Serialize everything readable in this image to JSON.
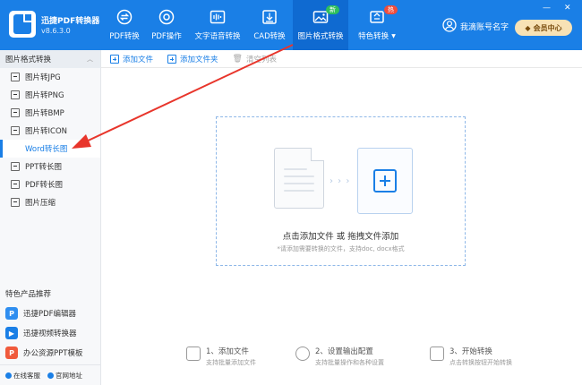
{
  "app": {
    "name": "迅捷PDF转换器",
    "version": "v8.6.3.0"
  },
  "nav": [
    {
      "label": "PDF转换",
      "icon": "pdf-convert-icon"
    },
    {
      "label": "PDF操作",
      "icon": "pdf-operation-icon"
    },
    {
      "label": "文字语音转换",
      "icon": "text-to-speech-icon"
    },
    {
      "label": "CAD转换",
      "icon": "cad-convert-icon"
    },
    {
      "label": "图片格式转换",
      "icon": "image-convert-icon",
      "badge": "新",
      "active": true
    },
    {
      "label": "特色转换",
      "icon": "special-convert-icon",
      "badge": "热"
    }
  ],
  "user": {
    "name": "我滴账号名字",
    "vip_label": "会员中心"
  },
  "window": {
    "min": "—",
    "close": "✕"
  },
  "sidebar": {
    "section_title": "图片格式转换",
    "items": [
      {
        "label": "图片转JPG"
      },
      {
        "label": "图片转PNG"
      },
      {
        "label": "图片转BMP"
      },
      {
        "label": "图片转ICON"
      },
      {
        "label": "Word转长图",
        "active": true
      },
      {
        "label": "PPT转长图"
      },
      {
        "label": "PDF转长图"
      },
      {
        "label": "图片压缩"
      }
    ],
    "recommend_title": "特色产品推荐",
    "recommend": [
      {
        "label": "迅捷PDF编辑器",
        "color": "#2f8ef0"
      },
      {
        "label": "迅捷视频转换器",
        "color": "#1a7fe6"
      },
      {
        "label": "办公资源PPT模板",
        "color": "#f05a3c"
      }
    ],
    "bottom_links": [
      "在线客服",
      "官网地址"
    ]
  },
  "toolbar": {
    "add_file": "添加文件",
    "add_folder": "添加文件夹",
    "clear_list": "清空列表"
  },
  "dropzone": {
    "main_text": "点击添加文件 或 拖拽文件添加",
    "sub_text": "*请添加需要转换的文件，支持doc, docx格式",
    "arrows": "› › ›"
  },
  "steps": [
    {
      "title": "1、添加文件",
      "desc": "支持批量添加文件"
    },
    {
      "title": "2、设置输出配置",
      "desc": "支持批量操作和各种设置"
    },
    {
      "title": "3、开始转换",
      "desc": "点击转换按钮开始转换"
    }
  ],
  "colors": {
    "primary": "#1a7fe6",
    "annotation_arrow": "#e8352b"
  }
}
